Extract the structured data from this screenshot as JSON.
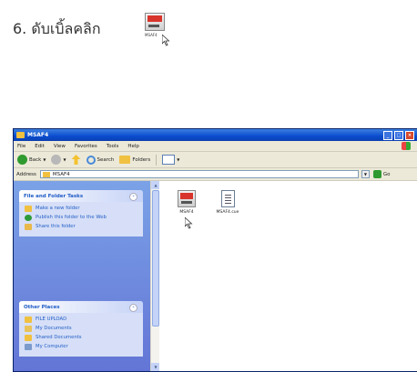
{
  "instruction": {
    "text": "6. ดับเบิ้ลคลิก",
    "icon_label": "MSAF4"
  },
  "window": {
    "title": "MSAF4",
    "menu": [
      "File",
      "Edit",
      "View",
      "Favorites",
      "Tools",
      "Help"
    ],
    "toolbar": {
      "back": "Back",
      "search": "Search",
      "folders": "Folders"
    },
    "address": {
      "label": "Address",
      "value": "MSAF4",
      "go": "Go"
    },
    "file_tasks": {
      "header": "File and Folder Tasks",
      "items": [
        "Make a new folder",
        "Publish this folder to the Web",
        "Share this folder"
      ]
    },
    "other_places": {
      "header": "Other Places",
      "items": [
        "FILE UPLOAD",
        "My Documents",
        "Shared Documents",
        "My Computer"
      ]
    },
    "files": [
      {
        "name": "MSAF4",
        "icon": "msafe-app-icon"
      },
      {
        "name": "MSAF4.cue",
        "icon": "cue-file-icon"
      }
    ]
  },
  "colors": {
    "titlebar": "#0a4ccf",
    "taskpane": "#6b84d9",
    "link": "#215dc6"
  }
}
